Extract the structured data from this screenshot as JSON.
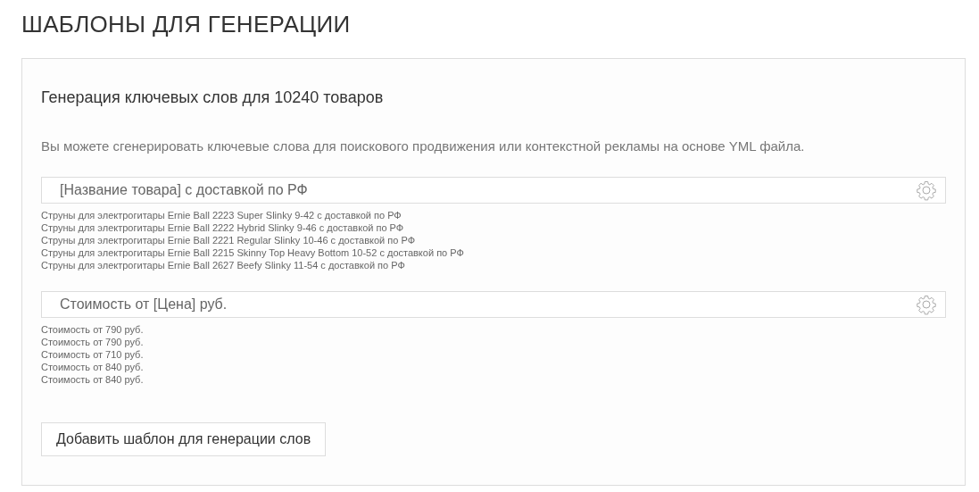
{
  "page_title": "ШАБЛОНЫ ДЛЯ ГЕНЕРАЦИИ",
  "panel": {
    "heading": "Генерация ключевых слов для 10240 товаров",
    "description": "Вы можете сгенерировать ключевые слова для поискового продвижения или контекстной рекламы на основе YML файла.",
    "templates": [
      {
        "value": "[Название товара] с доставкой по РФ",
        "examples": [
          "Струны для электрогитары Ernie Ball 2223 Super Slinky 9-42 с доставкой по РФ",
          "Струны для электрогитары Ernie Ball 2222 Hybrid Slinky 9-46 с доставкой по РФ",
          "Струны для электрогитары Ernie Ball 2221 Regular Slinky 10-46 с доставкой по РФ",
          "Струны для электрогитары Ernie Ball 2215 Skinny Top Heavy Bottom 10-52 с доставкой по РФ",
          "Струны для электрогитары Ernie Ball 2627 Beefy Slinky 11-54 с доставкой по РФ"
        ]
      },
      {
        "value": "Стоимость от [Цена] руб.",
        "examples": [
          "Стоимость от 790 руб.",
          "Стоимость от 790 руб.",
          "Стоимость от 710 руб.",
          "Стоимость от 840 руб.",
          "Стоимость от 840 руб."
        ]
      }
    ],
    "add_button": "Добавить шаблон для генерации слов"
  }
}
